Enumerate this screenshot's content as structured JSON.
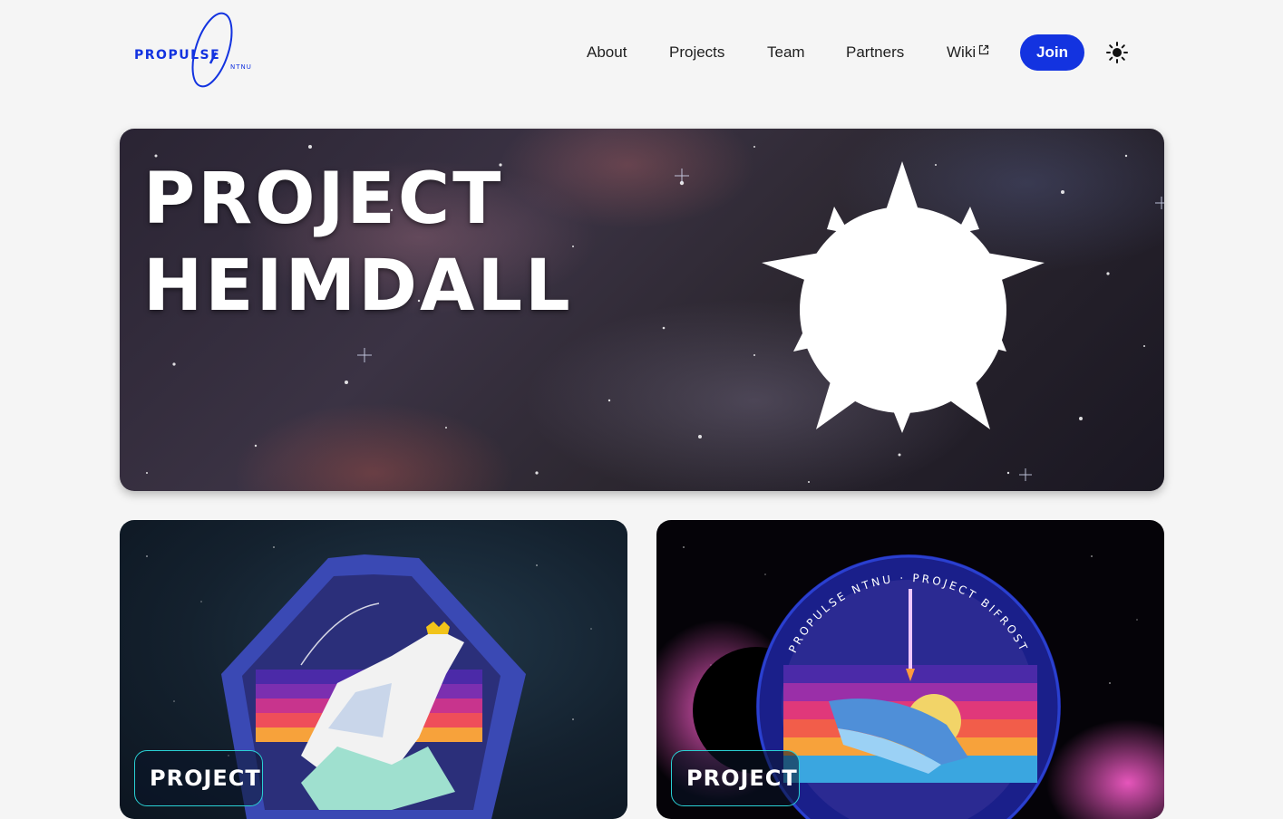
{
  "header": {
    "logo_text": "PROPULSE",
    "logo_subtext": "NTNU",
    "nav": [
      {
        "label": "About"
      },
      {
        "label": "Projects"
      },
      {
        "label": "Team"
      },
      {
        "label": "Partners"
      },
      {
        "label": "Wiki",
        "icon": "external-link-icon"
      }
    ],
    "join_label": "Join",
    "theme_icon": "sun-icon"
  },
  "hero": {
    "title_line1": "PROJECT",
    "title_line2": "HEIMDALL",
    "emblem_icon": "heimdall-emblem-icon"
  },
  "cards": [
    {
      "label": "PROJECT",
      "art": "polar-bear-patch"
    },
    {
      "label": "PROJECT",
      "art": "project-bifrost-patch",
      "patch_text": "PROPULSE NTNU · PROJECT BIFROST"
    }
  ],
  "colors": {
    "accent": "#1333e0",
    "background": "#f5f5f5",
    "card_tag_border": "#2ad0d4"
  }
}
